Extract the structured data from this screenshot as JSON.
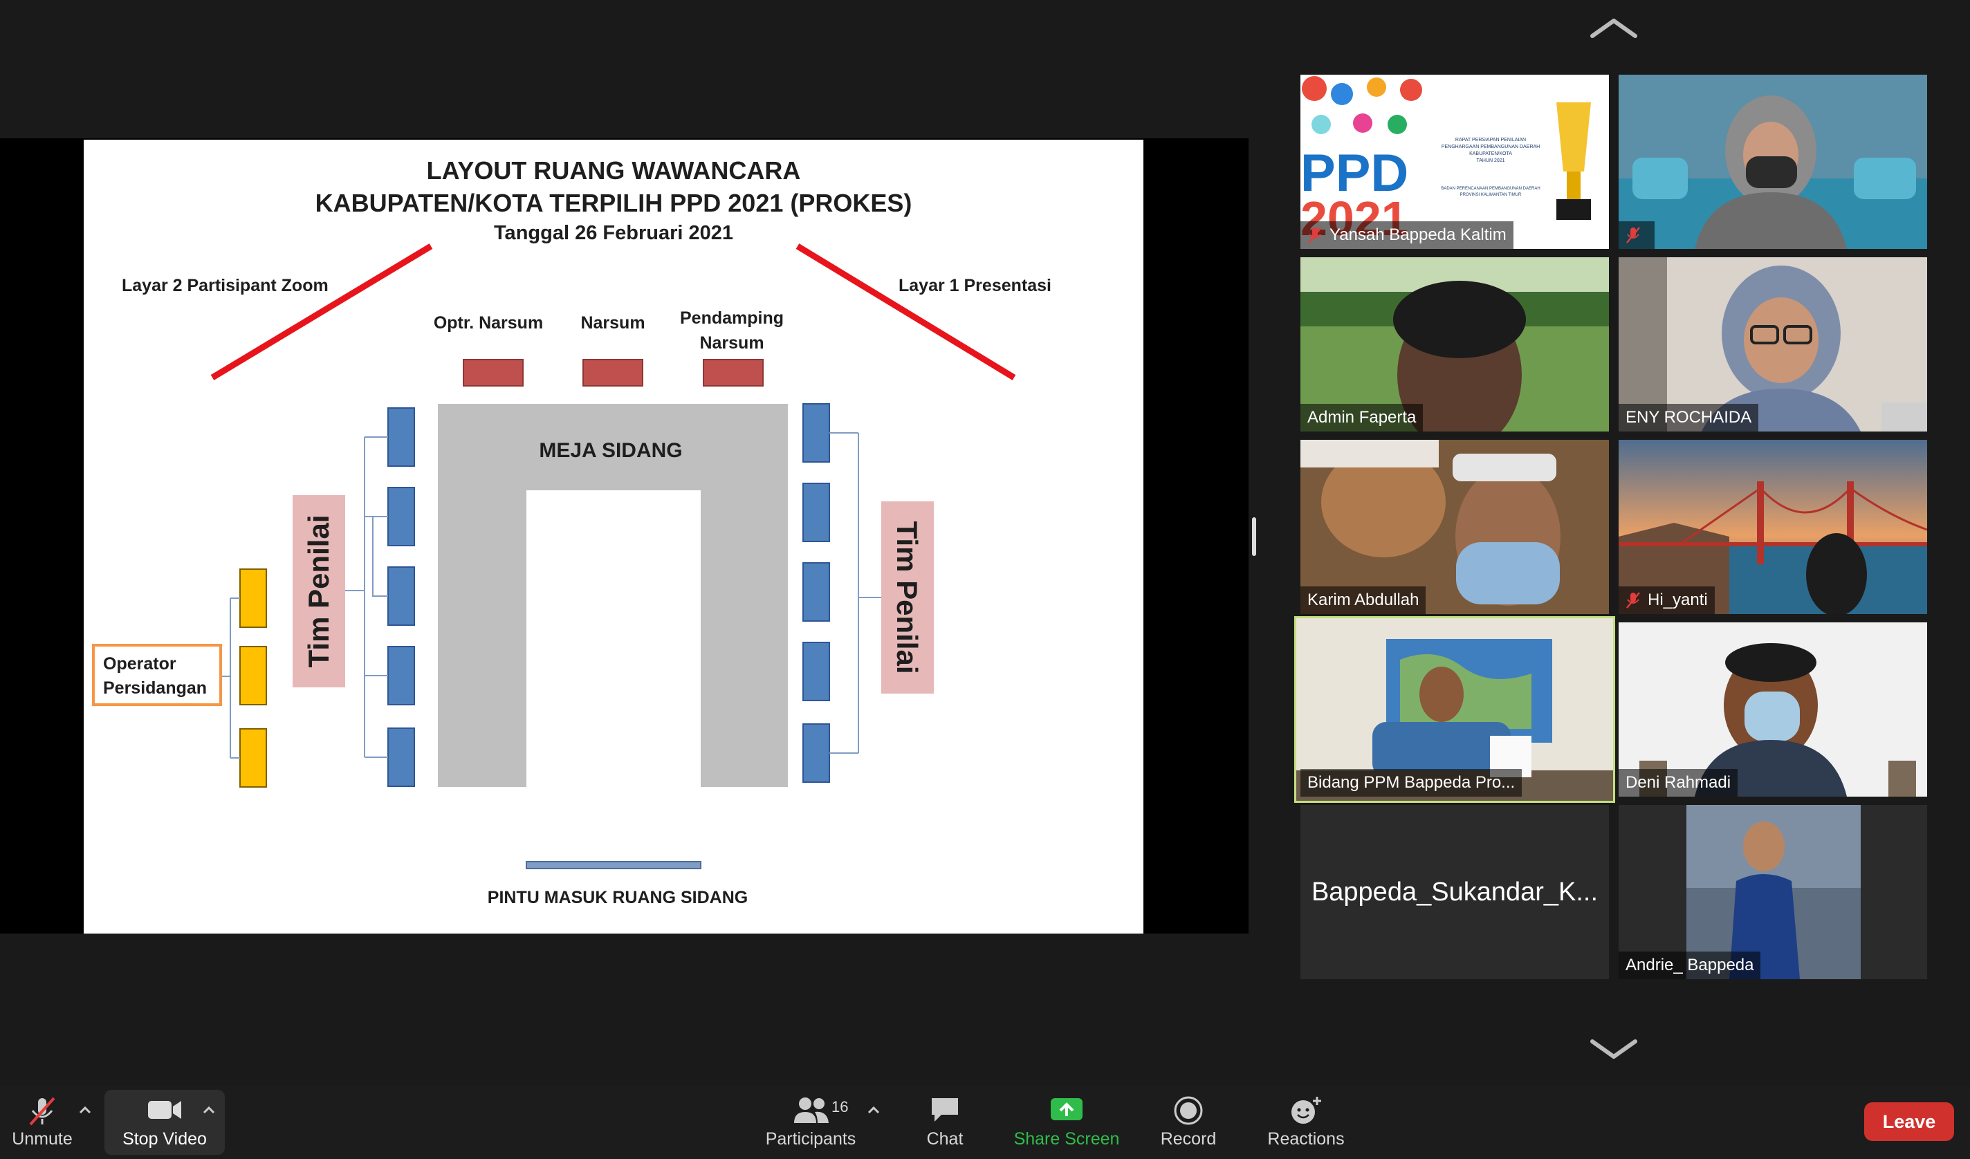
{
  "slide": {
    "title_line1": "LAYOUT RUANG WAWANCARA",
    "title_line2": "KABUPATEN/KOTA TERPILIH PPD 2021 (PROKES)",
    "date_line": "Tanggal 26 Februari 2021",
    "screen_left_label": "Layar 2 Partisipant Zoom",
    "screen_right_label": "Layar 1 Presentasi",
    "seat_label_1": "Optr. Narsum",
    "seat_label_2": "Narsum",
    "seat_label_3_line1": "Pendamping",
    "seat_label_3_line2": "Narsum",
    "table_label": "MEJA SIDANG",
    "panel_left_label": "Tim Penilai",
    "panel_right_label": "Tim Penilai",
    "operator_line1": "Operator",
    "operator_line2": "Persidangan",
    "entrance_label": "PINTU MASUK RUANG SIDANG"
  },
  "thumbnail": {
    "heading": "PPD",
    "heading_year": "2021",
    "caption_line1": "RAPAT PERSIAPAN PENILAIAN",
    "caption_line2": "PENGHARGAAN PEMBANGUNAN DAERAH",
    "caption_line3": "KABUPATEN/KOTA",
    "caption_line4": "TAHUN 2021",
    "caption_line5": "BADAN PERENCANAAN PEMBANGUNAN DAERAH",
    "caption_line6": "PROVINSI KALIMANTAN TIMUR"
  },
  "participants": [
    {
      "name": "Yansah Bappeda Kaltim",
      "muted": true
    },
    {
      "name": "",
      "muted": true
    },
    {
      "name": "Admin Faperta",
      "muted": false
    },
    {
      "name": "ENY ROCHAIDA",
      "muted": false
    },
    {
      "name": "Karim Abdullah",
      "muted": false
    },
    {
      "name": "Hi_yanti",
      "muted": true
    },
    {
      "name": "Bidang PPM Bappeda Pro...",
      "muted": false,
      "active": true
    },
    {
      "name": "Deni Rahmadi",
      "muted": false
    },
    {
      "name": "Bappeda_Sukandar_K...",
      "muted": false,
      "video_off": true
    },
    {
      "name": "Andrie_ Bappeda",
      "muted": false
    }
  ],
  "toolbar": {
    "unmute_label": "Unmute",
    "stop_video_label": "Stop Video",
    "participants_label": "Participants",
    "participants_count": "16",
    "chat_label": "Chat",
    "share_label": "Share Screen",
    "record_label": "Record",
    "reactions_label": "Reactions",
    "leave_label": "Leave"
  },
  "colors": {
    "share_green": "#2fbc4a",
    "leave_red": "#d0312d",
    "active_speaker": "#c3e07a",
    "slide_red_line": "#e8141c",
    "seat_red": "#c0504d",
    "seat_blue": "#4f81bd",
    "seat_yellow": "#ffc000",
    "panel_pink": "#e6b9b8",
    "table_gray": "#bfbfbf",
    "operator_orange": "#f79646"
  }
}
